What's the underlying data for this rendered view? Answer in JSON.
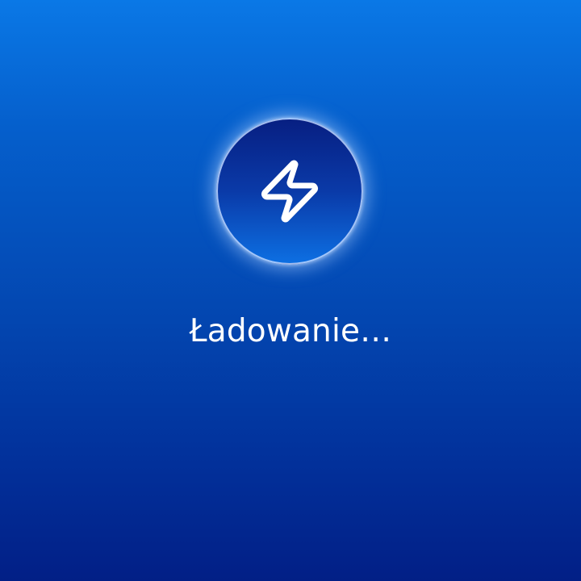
{
  "screen": {
    "loading_text": "Ładowanie…",
    "icon": "lightning-bolt-icon"
  },
  "colors": {
    "background_top": "#0a78e6",
    "background_bottom": "#021f86",
    "badge_top": "#071f82",
    "badge_bottom": "#0d6fe2",
    "glow": "#aacdff",
    "text": "#ffffff"
  }
}
